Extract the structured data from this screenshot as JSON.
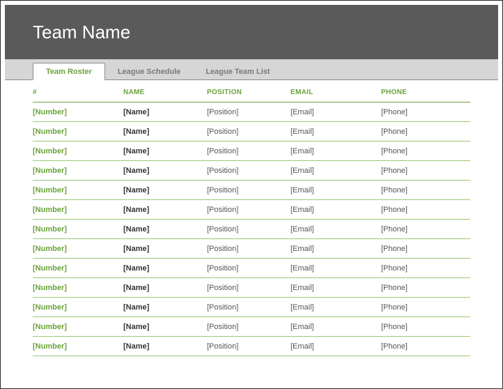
{
  "header": {
    "title": "Team Name"
  },
  "tabs": [
    {
      "label": "Team Roster",
      "active": true
    },
    {
      "label": "League Schedule",
      "active": false
    },
    {
      "label": "League Team List",
      "active": false
    }
  ],
  "columns": {
    "number": "#",
    "name": "NAME",
    "position": "POSITION",
    "email": "EMAIL",
    "phone": "PHONE"
  },
  "rows": [
    {
      "number": "[Number]",
      "name": "[Name]",
      "position": "[Position]",
      "email": "[Email]",
      "phone": "[Phone]"
    },
    {
      "number": "[Number]",
      "name": "[Name]",
      "position": "[Position]",
      "email": "[Email]",
      "phone": "[Phone]"
    },
    {
      "number": "[Number]",
      "name": "[Name]",
      "position": "[Position]",
      "email": "[Email]",
      "phone": "[Phone]"
    },
    {
      "number": "[Number]",
      "name": "[Name]",
      "position": "[Position]",
      "email": "[Email]",
      "phone": "[Phone]"
    },
    {
      "number": "[Number]",
      "name": "[Name]",
      "position": "[Position]",
      "email": "[Email]",
      "phone": "[Phone]"
    },
    {
      "number": "[Number]",
      "name": "[Name]",
      "position": "[Position]",
      "email": "[Email]",
      "phone": "[Phone]"
    },
    {
      "number": "[Number]",
      "name": "[Name]",
      "position": "[Position]",
      "email": "[Email]",
      "phone": "[Phone]"
    },
    {
      "number": "[Number]",
      "name": "[Name]",
      "position": "[Position]",
      "email": "[Email]",
      "phone": "[Phone]"
    },
    {
      "number": "[Number]",
      "name": "[Name]",
      "position": "[Position]",
      "email": "[Email]",
      "phone": "[Phone]"
    },
    {
      "number": "[Number]",
      "name": "[Name]",
      "position": "[Position]",
      "email": "[Email]",
      "phone": "[Phone]"
    },
    {
      "number": "[Number]",
      "name": "[Name]",
      "position": "[Position]",
      "email": "[Email]",
      "phone": "[Phone]"
    },
    {
      "number": "[Number]",
      "name": "[Name]",
      "position": "[Position]",
      "email": "[Email]",
      "phone": "[Phone]"
    },
    {
      "number": "[Number]",
      "name": "[Name]",
      "position": "[Position]",
      "email": "[Email]",
      "phone": "[Phone]"
    }
  ]
}
